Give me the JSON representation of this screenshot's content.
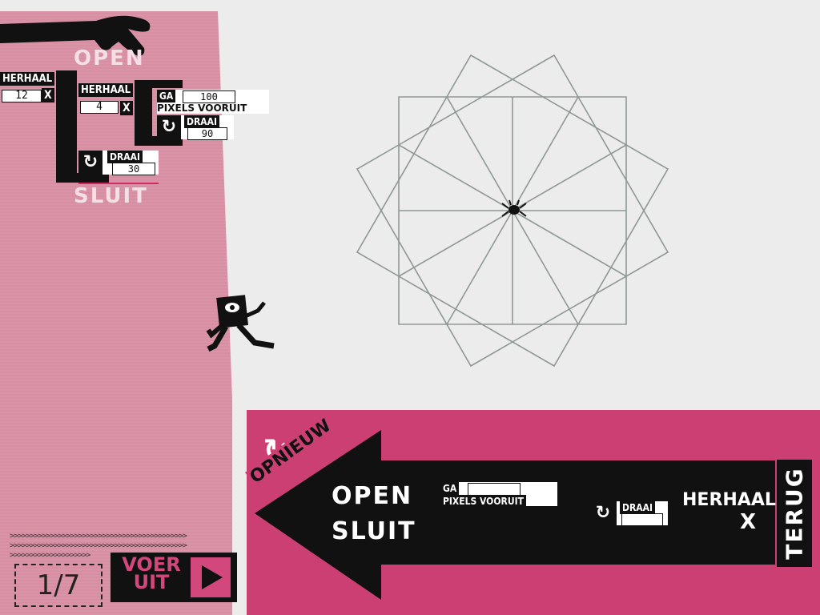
{
  "program": {
    "open_label": "OPEN",
    "close_label": "SLUIT",
    "repeat_outer": {
      "label": "HERHAAL",
      "count": "12",
      "times": "X"
    },
    "repeat_inner": {
      "label": "HERHAAL",
      "count": "4",
      "times": "X"
    },
    "go_block": {
      "label": "GA",
      "value": "100",
      "sublabel": "PIXELS VOORUIT"
    },
    "turn_inner": {
      "label": "DRAAI",
      "value": "90"
    },
    "turn_outer": {
      "label": "DRAAI",
      "value": "30"
    }
  },
  "palette": {
    "open_label": "OPEN",
    "close_label": "SLUIT",
    "go_label": "GA",
    "go_sublabel": "PIXELS VOORUIT",
    "turn_label": "DRAAI",
    "repeat_label": "HERHAAL",
    "repeat_times": "X",
    "restart_label": "OPNIEUW",
    "back_label": "TERUG"
  },
  "controls": {
    "run_label_line1": "VOER",
    "run_label_line2": "UIT",
    "page_indicator": "1/7"
  },
  "drawing": {
    "squares": 3,
    "rotation_step_deg": 30,
    "side_length": 100
  },
  "colors": {
    "left_panel": "#d78ea3",
    "bottom_panel": "#cc3f72",
    "block_black": "#111111",
    "run_accent": "#d2487d"
  }
}
